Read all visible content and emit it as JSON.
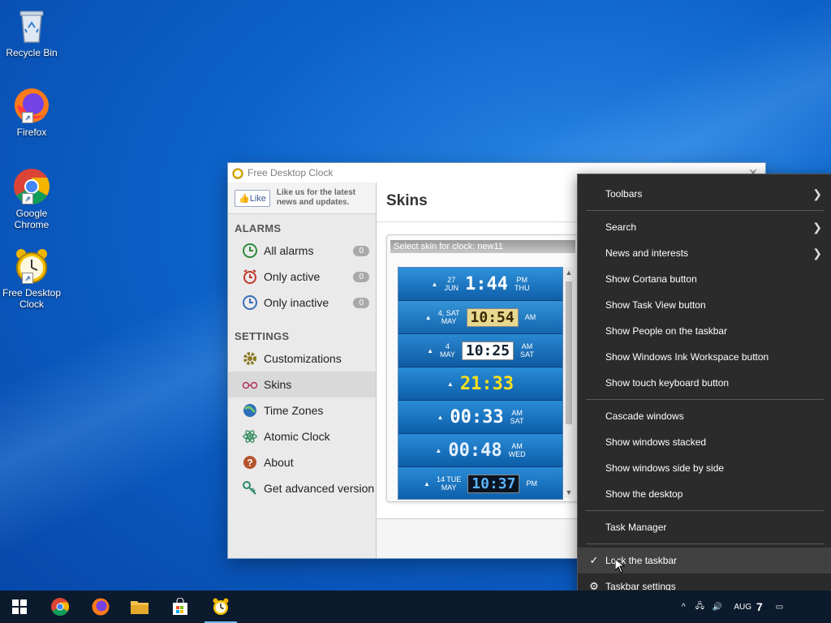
{
  "desktop": {
    "icons": [
      {
        "label": "Recycle Bin"
      },
      {
        "label": "Firefox"
      },
      {
        "label": "Google Chrome"
      },
      {
        "label": "Free Desktop Clock"
      }
    ]
  },
  "app": {
    "title": "Free Desktop Clock",
    "like_button": "Like",
    "like_text": "Like us for the latest news and updates.",
    "alarms_heading": "ALARMS",
    "alarms": [
      {
        "label": "All alarms",
        "count": "0"
      },
      {
        "label": "Only active",
        "count": "0"
      },
      {
        "label": "Only inactive",
        "count": "0"
      }
    ],
    "settings_heading": "SETTINGS",
    "settings": [
      {
        "label": "Customizations"
      },
      {
        "label": "Skins"
      },
      {
        "label": "Time Zones"
      },
      {
        "label": "Atomic Clock"
      },
      {
        "label": "About"
      },
      {
        "label": "Get advanced version"
      }
    ],
    "main_title": "Skins",
    "skin_header": "Select skin for clock: new11",
    "skins": [
      {
        "date_top": "27",
        "date_bottom": "JUN",
        "time": "1:44",
        "suffix_top": "PM",
        "suffix_bottom": "THU"
      },
      {
        "date_top": "4, SAT",
        "date_bottom": "MAY",
        "time": "10:54",
        "suffix_top": "AM",
        "suffix_bottom": ""
      },
      {
        "date_top": "4",
        "date_bottom": "MAY",
        "time": "10:25",
        "suffix_top": "AM",
        "suffix_bottom": "SAT"
      },
      {
        "date_top": "",
        "date_bottom": "",
        "time": "21:33",
        "suffix_top": "",
        "suffix_bottom": ""
      },
      {
        "date_top": "",
        "date_bottom": "",
        "time": "00:33",
        "suffix_top": "AM",
        "suffix_bottom": "SAT"
      },
      {
        "date_top": "",
        "date_bottom": "",
        "time": "00:48",
        "suffix_top": "AM",
        "suffix_bottom": "WED"
      },
      {
        "date_top": "14 TUE",
        "date_bottom": "MAY",
        "time": "10:37",
        "suffix_top": "PM",
        "suffix_bottom": ""
      }
    ]
  },
  "context_menu": {
    "items": [
      {
        "label": "Toolbars",
        "submenu": true
      },
      {
        "label": "Search",
        "submenu": true
      },
      {
        "label": "News and interests",
        "submenu": true
      },
      {
        "label": "Show Cortana button"
      },
      {
        "label": "Show Task View button"
      },
      {
        "label": "Show People on the taskbar"
      },
      {
        "label": "Show Windows Ink Workspace button"
      },
      {
        "label": "Show touch keyboard button"
      },
      {
        "label": "Cascade windows"
      },
      {
        "label": "Show windows stacked"
      },
      {
        "label": "Show windows side by side"
      },
      {
        "label": "Show the desktop"
      },
      {
        "label": "Task Manager"
      },
      {
        "label": "Lock the taskbar",
        "checked": true
      },
      {
        "label": "Taskbar settings"
      }
    ]
  },
  "taskbar": {
    "tray_month": "AUG",
    "tray_day": "7"
  },
  "colors": {
    "desktop_blue": "#0d62c9",
    "menu_bg": "#2b2b2b",
    "taskbar_bg": "#0b1a2c",
    "skin_blue": "#1a72c0"
  }
}
